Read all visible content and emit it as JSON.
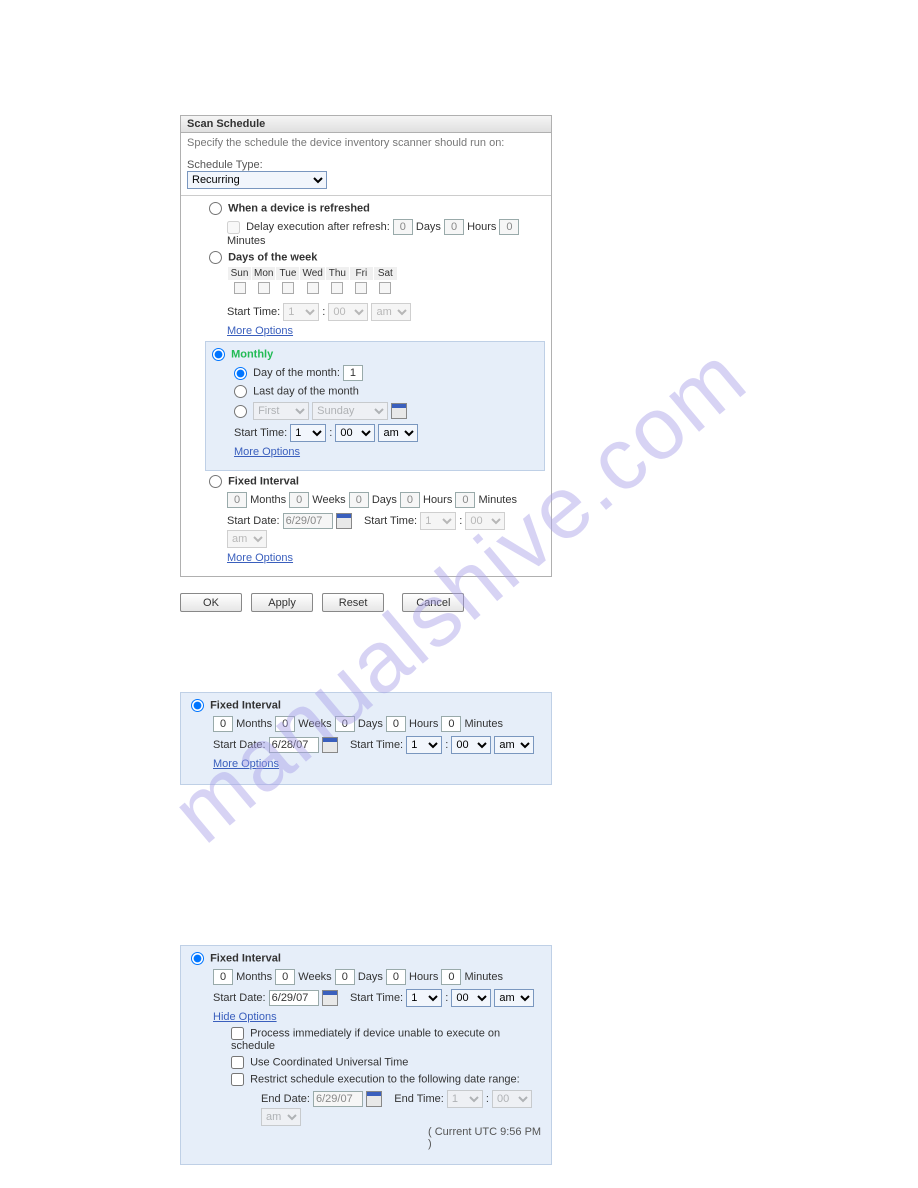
{
  "panel": {
    "title": "Scan Schedule",
    "instruction": "Specify the schedule the device inventory scanner should run on:",
    "scheduleTypeLabel": "Schedule Type:",
    "scheduleTypeValue": "Recurring"
  },
  "refresh": {
    "label": "When a device is refreshed",
    "delayLabel": "Delay execution after refresh:",
    "days": "0",
    "daysLabel": "Days",
    "hours": "0",
    "hoursLabel": "Hours",
    "minutes": "0",
    "minutesLabel": "Minutes"
  },
  "dow": {
    "label": "Days of the week",
    "days": [
      "Sun",
      "Mon",
      "Tue",
      "Wed",
      "Thu",
      "Fri",
      "Sat"
    ],
    "startTimeLabel": "Start Time:",
    "hour": "1",
    "minute": "00",
    "ampm": "am",
    "moreOptions": "More Options"
  },
  "monthly": {
    "label": "Monthly",
    "dayOfMonthLabel": "Day of the month:",
    "dayOfMonthValue": "1",
    "lastDayLabel": "Last day of the month",
    "ordinal": "First",
    "weekday": "Sunday",
    "startTimeLabel": "Start Time:",
    "hour": "1",
    "minute": "00",
    "ampm": "am",
    "moreOptions": "More Options"
  },
  "fixed1": {
    "label": "Fixed Interval",
    "months": "0",
    "monthsLabel": "Months",
    "weeks": "0",
    "weeksLabel": "Weeks",
    "days": "0",
    "daysLabel": "Days",
    "hours": "0",
    "hoursLabel": "Hours",
    "minutes": "0",
    "minutesLabel": "Minutes",
    "startDateLabel": "Start Date:",
    "startDate": "6/29/07",
    "startTimeLabel": "Start Time:",
    "hour": "1",
    "minute": "00",
    "ampm": "am",
    "moreOptions": "More Options"
  },
  "buttons": {
    "ok": "OK",
    "apply": "Apply",
    "reset": "Reset",
    "cancel": "Cancel"
  },
  "fixed2": {
    "label": "Fixed Interval",
    "months": "0",
    "monthsLabel": "Months",
    "weeks": "0",
    "weeksLabel": "Weeks",
    "days": "0",
    "daysLabel": "Days",
    "hours": "0",
    "hoursLabel": "Hours",
    "minutes": "0",
    "minutesLabel": "Minutes",
    "startDateLabel": "Start Date:",
    "startDate": "6/28/07",
    "startTimeLabel": "Start Time:",
    "hour": "1",
    "minute": "00",
    "ampm": "am",
    "moreOptions": "More Options"
  },
  "fixed3": {
    "label": "Fixed Interval",
    "months": "0",
    "monthsLabel": "Months",
    "weeks": "0",
    "weeksLabel": "Weeks",
    "days": "0",
    "daysLabel": "Days",
    "hours": "0",
    "hoursLabel": "Hours",
    "minutes": "0",
    "minutesLabel": "Minutes",
    "startDateLabel": "Start Date:",
    "startDate": "6/29/07",
    "startTimeLabel": "Start Time:",
    "hour": "1",
    "minute": "00",
    "ampm": "am",
    "hideOptions": "Hide Options",
    "opt1": "Process immediately if device unable to execute on schedule",
    "opt2": "Use Coordinated Universal Time",
    "opt3": "Restrict schedule execution to the following date range:",
    "endDateLabel": "End Date:",
    "endDate": "6/29/07",
    "endTimeLabel": "End Time:",
    "endHour": "1",
    "endMinute": "00",
    "endAmpm": "am",
    "utcNote": "( Current UTC 9:56 PM )"
  },
  "watermark": "manualshive.com"
}
